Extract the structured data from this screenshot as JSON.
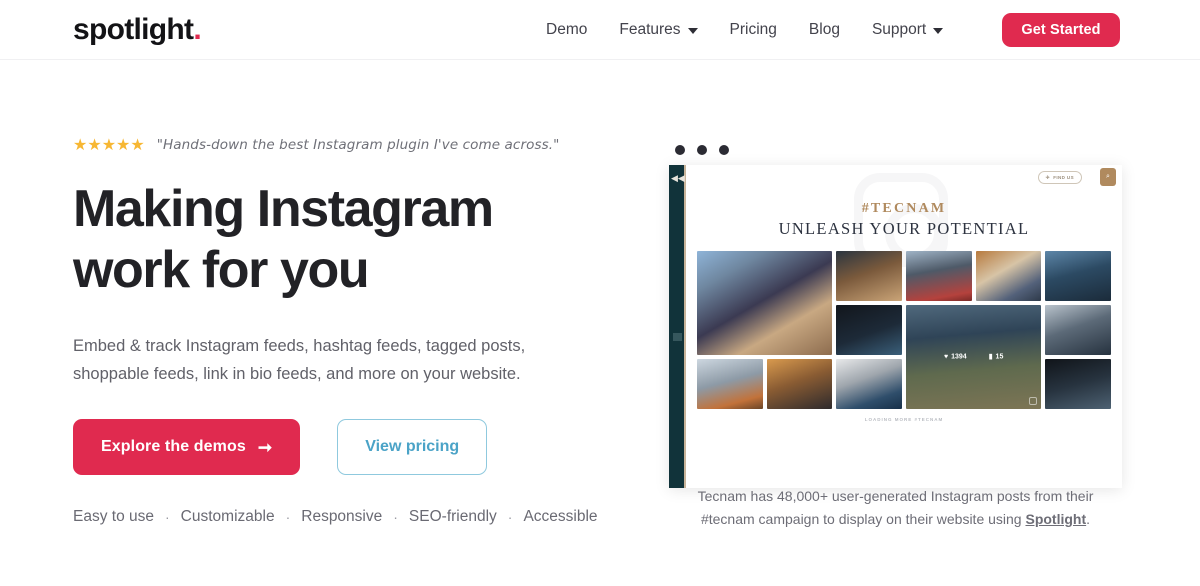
{
  "brand": {
    "logo_text": "spotlight",
    "logo_dot": ".",
    "accent_color": "#e02a4f",
    "star_color": "#f7b733",
    "secondary_border_color": "#8fc9de"
  },
  "header": {
    "nav": [
      {
        "label": "Demo",
        "has_caret": false
      },
      {
        "label": "Features",
        "has_caret": true
      },
      {
        "label": "Pricing",
        "has_caret": false
      },
      {
        "label": "Blog",
        "has_caret": false
      },
      {
        "label": "Support",
        "has_caret": true
      }
    ],
    "cta_label": "Get Started"
  },
  "hero": {
    "stars": "★★★★★",
    "quote": "\"Hands-down the best Instagram plugin I've come across.\"",
    "headline": "Making Instagram work for you",
    "subtext": "Embed & track Instagram feeds, hashtag feeds, tagged posts, shoppable feeds, link in bio feeds, and more on your website.",
    "primary_cta": "Explore the demos",
    "primary_cta_arrow": "➞",
    "secondary_cta": "View pricing",
    "features": [
      "Easy to use",
      "Customizable",
      "Responsive",
      "SEO-friendly",
      "Accessible"
    ],
    "feature_separator": "·"
  },
  "mockup": {
    "window_dots": 3,
    "sidebar_collapse_icon": "◀◀",
    "topbar_pill_label": "FIND US",
    "topbar_pill_icon": "✈",
    "topbar_round_icon": "⌕",
    "hashtag": "#TECNAM",
    "title": "UNLEASH YOUR POTENTIAL",
    "overlay_likes": "1394",
    "overlay_comments": "15",
    "overlay_like_glyph": "♥",
    "overlay_comment_glyph": "▮",
    "load_more": "LOADING MORE #TECNAM"
  },
  "caption": {
    "line1": "Tecnam has 48,000+ user-generated Instagram posts from their",
    "line2_prefix": "#tecnam campaign to display on their website using ",
    "link": "Spotlight",
    "line2_suffix": "."
  }
}
